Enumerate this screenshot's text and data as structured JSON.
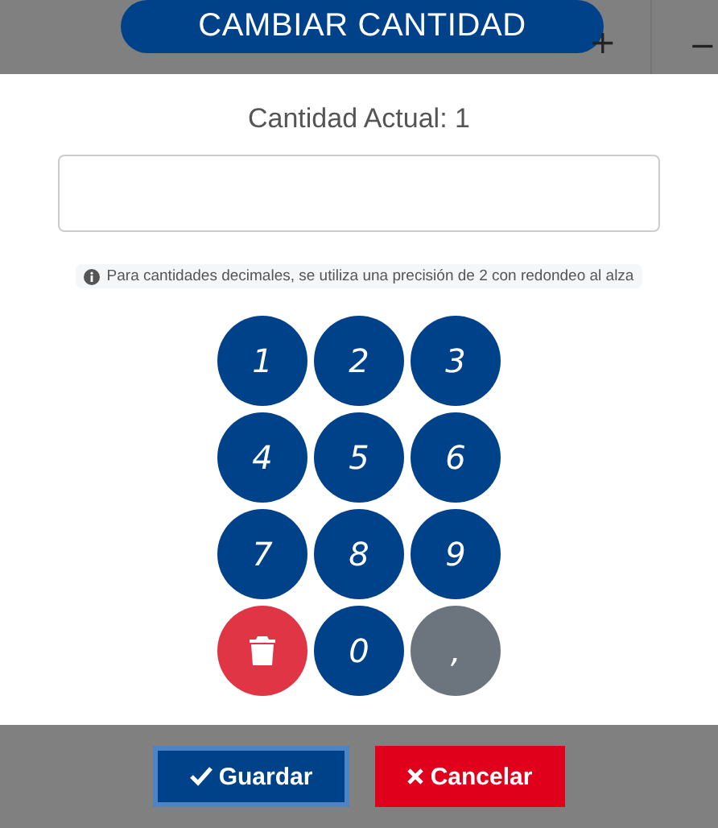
{
  "header": {
    "title": "CAMBIAR CANTIDAD",
    "increment": "+",
    "decrement": "−"
  },
  "current_quantity": "Cantidad Actual: 1",
  "info_note": "Para cantidades decimales, se utiliza una precisión de 2 con redondeo al alza",
  "keypad": [
    {
      "kind": "digit",
      "label": "1"
    },
    {
      "kind": "digit",
      "label": "2"
    },
    {
      "kind": "digit",
      "label": "3"
    },
    {
      "kind": "digit",
      "label": "4"
    },
    {
      "kind": "digit",
      "label": "5"
    },
    {
      "kind": "digit",
      "label": "6"
    },
    {
      "kind": "digit",
      "label": "7"
    },
    {
      "kind": "digit",
      "label": "8"
    },
    {
      "kind": "digit",
      "label": "9"
    },
    {
      "kind": "delete"
    },
    {
      "kind": "digit",
      "label": "0"
    },
    {
      "kind": "comma",
      "label": ","
    }
  ],
  "buttons": [
    {
      "kind": "save",
      "label": "Guardar"
    },
    {
      "kind": "cancel",
      "label": "Cancelar"
    }
  ]
}
